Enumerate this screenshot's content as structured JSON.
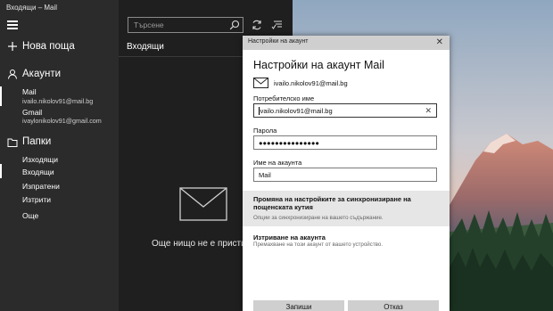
{
  "window": {
    "title": "Входящи – Mail"
  },
  "nav": {
    "new_mail": "Нова поща",
    "accounts_label": "Акаунти",
    "accounts": [
      {
        "name": "Mail",
        "email": "ivailo.nikolov91@mail.bg"
      },
      {
        "name": "Gmail",
        "email": "ivaylonikolov91@gmail.com"
      }
    ],
    "folders_label": "Папки",
    "folders": [
      "Изходящи",
      "Входящи",
      "Изпратени",
      "Изтрити"
    ],
    "more": "Още"
  },
  "middle": {
    "search_placeholder": "Търсене",
    "inbox_title": "Входящи",
    "empty_message": "Още нищо не е пристигн"
  },
  "dialog": {
    "title": "Настройки на акаунт",
    "heading": "Настройки на акаунт Mail",
    "account_email": "ivailo.nikolov91@mail.bg",
    "username_label": "Потребителско име",
    "username_value": "ivailo.nikolov91@mail.bg",
    "password_label": "Парола",
    "password_value": "●●●●●●●●●●●●●●●",
    "account_name_label": "Име на акаунта",
    "account_name_value": "Mail",
    "sync_title": "Промяна на настройките за синхронизиране на пощенската кутия",
    "sync_sub": "Опции за синхронизиране на вашето съдържание.",
    "delete_title": "Изтриване на акаунта",
    "delete_sub": "Премахване на този акаунт от вашето устройство.",
    "save_button": "Запиши",
    "cancel_button": "Отказ"
  },
  "colors": {
    "nav_bg": "#2b2b2b",
    "pane_bg": "#1f1f1f",
    "dialog_title_bg": "#cfcfcf",
    "sync_block_bg": "#e6e6e6"
  },
  "icons": {
    "hamburger": "hamburger-icon",
    "compose": "plus-icon",
    "accounts": "person-icon",
    "folders": "folder-icon",
    "search": "search-icon",
    "sync": "sync-icon",
    "filter": "filter-icon",
    "envelope": "envelope-icon",
    "close": "close-icon"
  }
}
